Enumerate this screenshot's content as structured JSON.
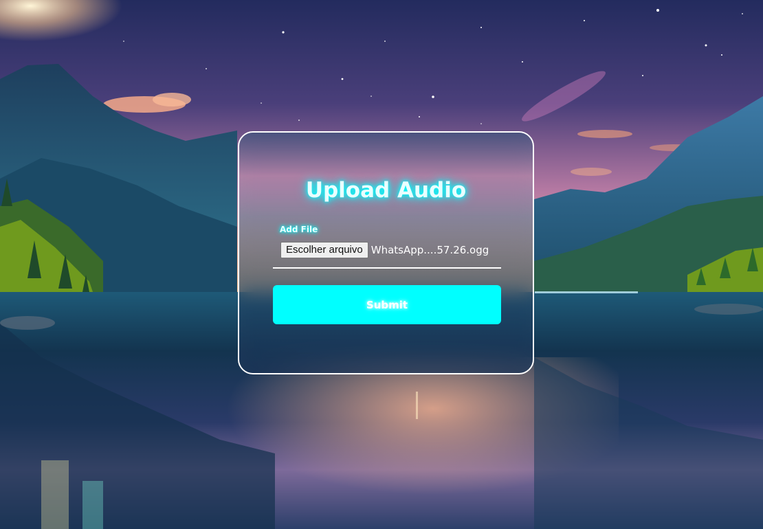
{
  "form": {
    "title": "Upload Audio",
    "file_label": "Add File",
    "file_button_label": "Escolher arquivo",
    "file_name": "WhatsApp....57.26.ogg",
    "submit_label": "Submit"
  },
  "colors": {
    "accent": "#00ffff",
    "card_border": "#ffffff",
    "title_glow": "#00ffff"
  }
}
